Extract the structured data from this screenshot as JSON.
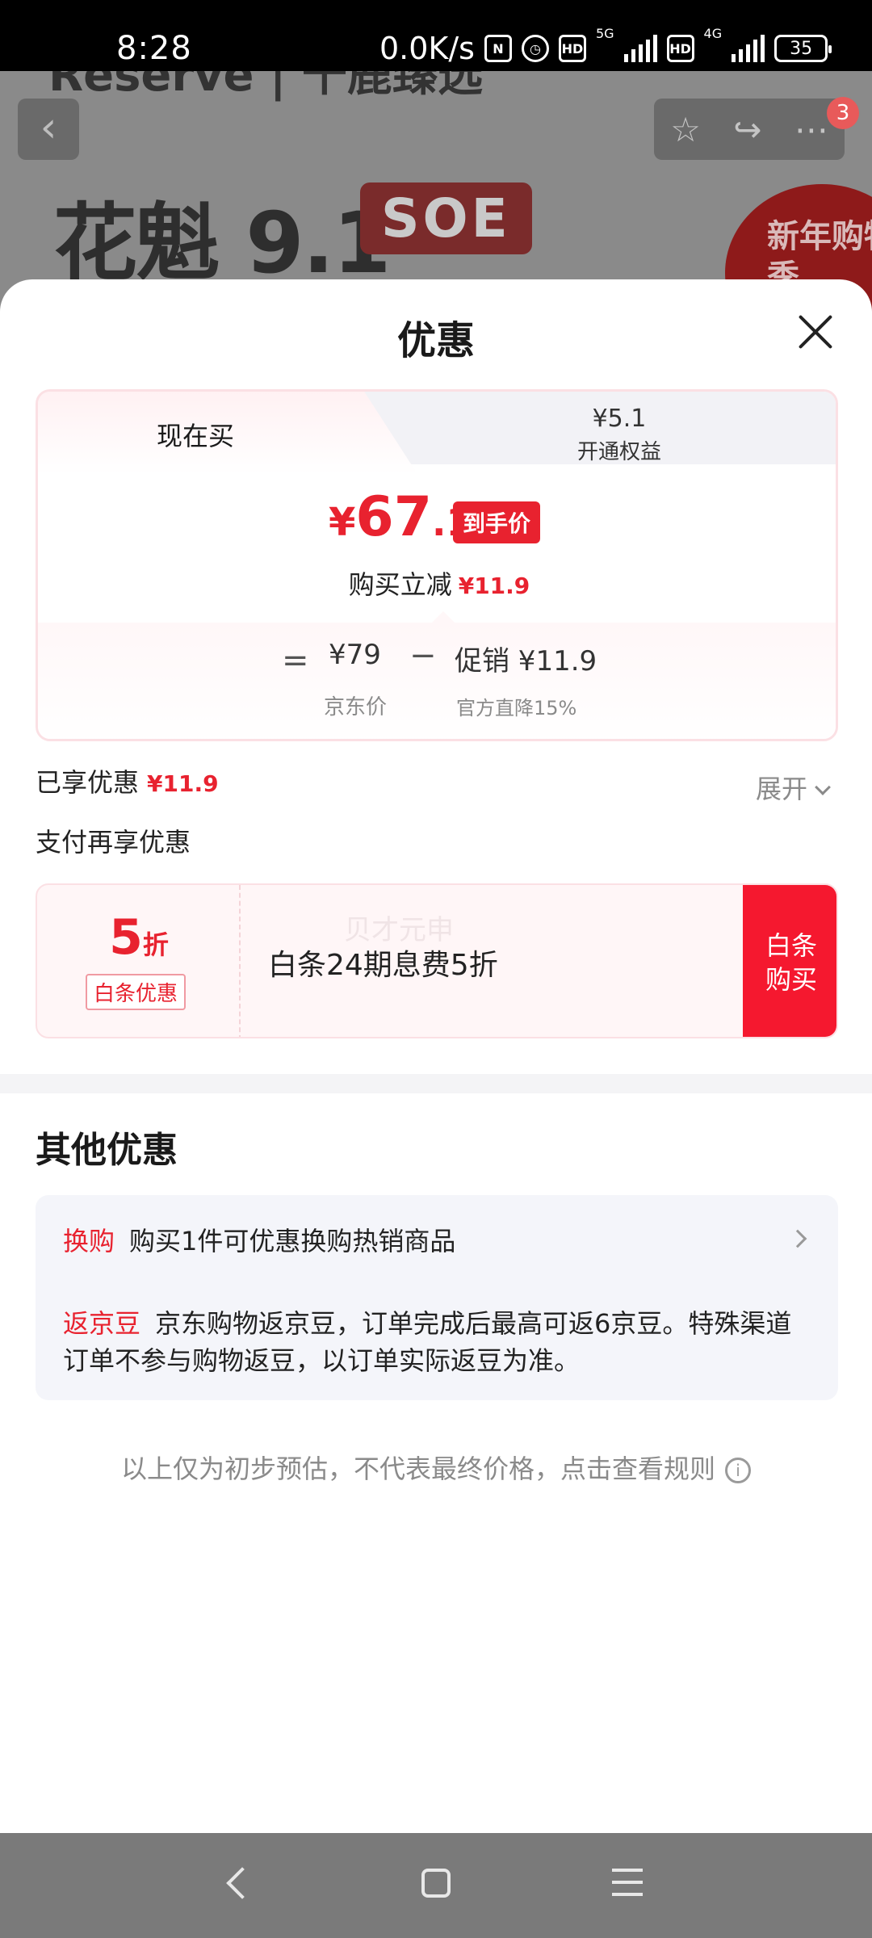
{
  "status_bar": {
    "time": "8:28",
    "speed": "0.0K/s",
    "battery": "35",
    "net1": "5G",
    "net2": "4G",
    "hd": "HD"
  },
  "background_page": {
    "brand": "Reserve | 千鹿臻选",
    "title": "花魁 9.1",
    "tag": "SOE",
    "promo": "新年购物季",
    "cart_badge": "3"
  },
  "sheet": {
    "title": "优惠",
    "tabs": {
      "now": "现在买",
      "other_price": "¥5.1",
      "other_label": "开通权益"
    },
    "price": {
      "currency": "¥",
      "int": "67",
      "dec": ".1",
      "tag": "到手价"
    },
    "reduce": {
      "label": "购买立减",
      "value": "¥11.9"
    },
    "breakdown": {
      "equals": "=",
      "minus": "−",
      "jd_price": "¥79",
      "jd_label": "京东价",
      "promo_price": "促销 ¥11.9",
      "promo_label": "官方直降15%"
    },
    "enjoyed": {
      "label": "已享优惠",
      "value": "¥11.9",
      "expand": "展开"
    },
    "pay_more": "支付再享优惠",
    "baitiao": {
      "discount": "5",
      "unit": "折",
      "badge": "白条优惠",
      "text": "白条24期息费5折",
      "watermark": "贝才元申",
      "button": "白条购买"
    },
    "other": {
      "title": "其他优惠",
      "items": [
        {
          "tag": "换购",
          "text": "购买1件可优惠换购热销商品"
        },
        {
          "tag": "返京豆",
          "text": "京东购物返京豆，订单完成后最高可返6京豆。特殊渠道订单不参与购物返豆，以订单实际返豆为准。"
        }
      ]
    },
    "footnote": "以上仅为初步预估，不代表最终价格，点击查看规则"
  },
  "colors": {
    "accent": "#e8222f",
    "button": "#f5182f",
    "muted": "#8a8a8a"
  }
}
